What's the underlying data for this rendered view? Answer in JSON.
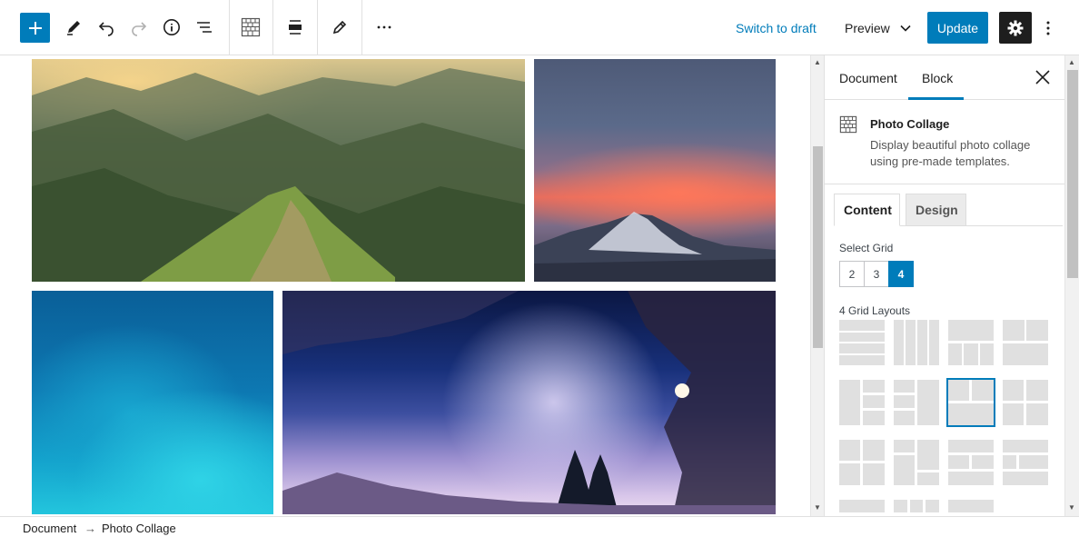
{
  "toolbar": {
    "switch_to_draft": "Switch to draft",
    "preview_label": "Preview",
    "update_label": "Update",
    "icons": [
      "plus-icon",
      "pencil-icon",
      "undo-icon",
      "redo-icon",
      "info-icon",
      "list-view-icon",
      "photo-collage-icon",
      "align-icon",
      "edit-icon",
      "more-options-icon",
      "chevron-down-icon",
      "gear-icon",
      "vertical-ellipsis-icon"
    ]
  },
  "sidebar": {
    "tabs": [
      {
        "label": "Document",
        "active": false
      },
      {
        "label": "Block",
        "active": true
      }
    ],
    "block": {
      "title": "Photo Collage",
      "description": "Display beautiful photo collage using pre-made templates."
    },
    "content_tabs": [
      {
        "label": "Content",
        "active": true
      },
      {
        "label": "Design",
        "active": false
      }
    ],
    "select_grid_label": "Select Grid",
    "grid_options": [
      "2",
      "3",
      "4"
    ],
    "grid_selected": "4",
    "layouts_label": "4 Grid Layouts",
    "selected_layout_index": 6
  },
  "footer": {
    "breadcrumb": [
      "Document",
      "Photo Collage"
    ],
    "separator": "→"
  },
  "colors": {
    "accent": "#007cba",
    "dark": "#1e1e1e",
    "border": "#e0e0e0"
  }
}
